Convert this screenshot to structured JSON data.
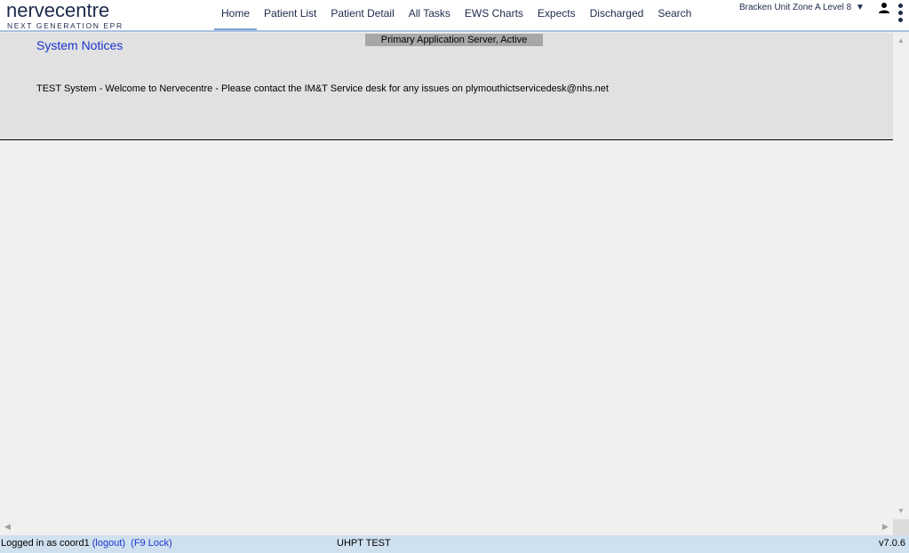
{
  "header": {
    "logo": {
      "main": "nervecentre",
      "sub": "NEXT GENERATION EPR"
    },
    "nav": [
      {
        "label": "Home",
        "active": true
      },
      {
        "label": "Patient List"
      },
      {
        "label": "Patient Detail"
      },
      {
        "label": "All Tasks"
      },
      {
        "label": "EWS Charts"
      },
      {
        "label": "Expects"
      },
      {
        "label": "Discharged"
      },
      {
        "label": "Search"
      }
    ],
    "location": "Bracken Unit Zone A Level 8",
    "location_caret": "▼"
  },
  "notices": {
    "server_status": "Primary Application Server, Active",
    "title": "System Notices",
    "message": "TEST System - Welcome to Nervecentre - Please contact the IM&T Service desk for any issues on plymouthictservicedesk@nhs.net"
  },
  "footer": {
    "logged_in_text": "Logged in as coord1",
    "logout_label": "(logout)",
    "lock_label": "(F9 Lock)",
    "environment": "UHPT TEST",
    "version": "v7.0.6"
  },
  "colors": {
    "brand": "#1d2a4d",
    "link": "#1a33cc",
    "nav_active": "#7aa3d4",
    "footer_bg": "#cfe0ef"
  }
}
